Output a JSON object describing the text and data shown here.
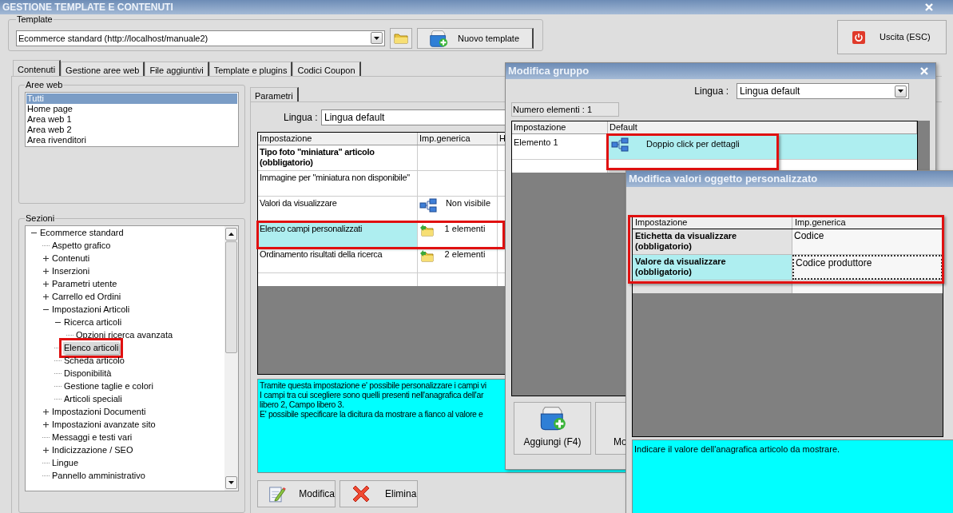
{
  "window": {
    "title": "GESTIONE TEMPLATE E CONTENUTI"
  },
  "template": {
    "label": "Template",
    "value": "Ecommerce standard (http://localhost/manuale2)",
    "new_button": "Nuovo template"
  },
  "exit_button": "Uscita (ESC)",
  "tabs": [
    {
      "label": "Contenuti",
      "selected": true
    },
    {
      "label": "Gestione aree web",
      "selected": false
    },
    {
      "label": "File aggiuntivi",
      "selected": false
    },
    {
      "label": "Template e plugins",
      "selected": false
    },
    {
      "label": "Codici Coupon",
      "selected": false
    }
  ],
  "web_areas": {
    "label": "Aree web",
    "items": [
      {
        "label": "Tutti",
        "selected": true
      },
      {
        "label": "Home page",
        "selected": false
      },
      {
        "label": "Area web 1",
        "selected": false
      },
      {
        "label": "Area web 2",
        "selected": false
      },
      {
        "label": "Area rivenditori",
        "selected": false
      }
    ]
  },
  "sections": {
    "label": "Sezioni",
    "tree": [
      {
        "label": "Ecommerce standard",
        "kind": "branch",
        "expanded": true,
        "selected": false,
        "highlighted": false,
        "children": [
          {
            "label": "Aspetto grafico",
            "kind": "leaf",
            "selected": false,
            "highlighted": false
          },
          {
            "label": "Contenuti",
            "kind": "branch",
            "expanded": false,
            "selected": false,
            "highlighted": false
          },
          {
            "label": "Inserzioni",
            "kind": "branch",
            "expanded": false,
            "selected": false,
            "highlighted": false
          },
          {
            "label": "Parametri utente",
            "kind": "branch",
            "expanded": false,
            "selected": false,
            "highlighted": false
          },
          {
            "label": "Carrello ed Ordini",
            "kind": "branch",
            "expanded": false,
            "selected": false,
            "highlighted": false
          },
          {
            "label": "Impostazioni Articoli",
            "kind": "branch",
            "expanded": true,
            "selected": false,
            "highlighted": false,
            "children": [
              {
                "label": "Ricerca articoli",
                "kind": "branch",
                "expanded": true,
                "selected": false,
                "highlighted": false,
                "children": [
                  {
                    "label": "Opzioni ricerca avanzata",
                    "kind": "leaf",
                    "selected": false,
                    "highlighted": false
                  }
                ]
              },
              {
                "label": "Elenco articoli",
                "kind": "leaf",
                "selected": true,
                "highlighted": true
              },
              {
                "label": "Scheda articolo",
                "kind": "leaf",
                "selected": false,
                "highlighted": false
              },
              {
                "label": "Disponibilità",
                "kind": "leaf",
                "selected": false,
                "highlighted": false
              },
              {
                "label": "Gestione taglie e colori",
                "kind": "leaf",
                "selected": false,
                "highlighted": false
              },
              {
                "label": "Articoli speciali",
                "kind": "leaf",
                "selected": false,
                "highlighted": false
              }
            ]
          },
          {
            "label": "Impostazioni Documenti",
            "kind": "branch",
            "expanded": false,
            "selected": false,
            "highlighted": false
          },
          {
            "label": "Impostazioni avanzate sito",
            "kind": "branch",
            "expanded": false,
            "selected": false,
            "highlighted": false
          },
          {
            "label": "Messaggi e testi vari",
            "kind": "leaf",
            "selected": false,
            "highlighted": false
          },
          {
            "label": "Indicizzazione / SEO",
            "kind": "branch",
            "expanded": false,
            "selected": false,
            "highlighted": false
          },
          {
            "label": "Lingue",
            "kind": "leaf",
            "selected": false,
            "highlighted": false
          },
          {
            "label": "Pannello amministrativo",
            "kind": "leaf",
            "selected": false,
            "highlighted": false
          }
        ]
      }
    ]
  },
  "parameters": {
    "tab": "Parametri",
    "language_label": "Lingua :",
    "language_value": "Lingua default",
    "columns": [
      "Impostazione",
      "Imp.generica",
      "H"
    ],
    "rows": [
      {
        "label": "Tipo foto \"miniatura\" articolo (obbligatorio)",
        "bold": true,
        "kind": "plain",
        "selected": false,
        "highlighted": false
      },
      {
        "label": "Immagine per \"miniatura non disponibile\"",
        "bold": false,
        "kind": "plain",
        "selected": false,
        "highlighted": false
      },
      {
        "label": "Valori da visualizzare",
        "bold": false,
        "kind": "detail",
        "value": "Non visibile",
        "selected": false,
        "highlighted": false
      },
      {
        "label": "Elenco campi personalizzati",
        "bold": false,
        "kind": "list",
        "value": "1 elementi",
        "selected": true,
        "highlighted": true
      },
      {
        "label": "Ordinamento risultati della ricerca",
        "bold": false,
        "kind": "list",
        "value": "2 elementi",
        "selected": false,
        "highlighted": false
      }
    ],
    "description": [
      "Tramite questa impostazione e' possibile personalizzare i campi vi",
      "I campi tra cui scegliere sono quelli presenti nell'anagrafica dell'ar",
      "libero 2, Campo libero 3.",
      "E' possibile specificare la dicitura da mostrare a fianco al valore e"
    ],
    "buttons": [
      {
        "label": "Modifica",
        "kind": "edit"
      },
      {
        "label": "Elimina",
        "kind": "delete"
      }
    ]
  },
  "group_dialog": {
    "title": "Modifica gruppo",
    "language_label": "Lingua :",
    "language_value": "Lingua default",
    "count": "Numero elementi : 1",
    "columns": [
      "Impostazione",
      "Default"
    ],
    "rows": [
      {
        "label": "Elemento 1",
        "value": "Doppio click per dettagli",
        "selected": true,
        "highlighted": true
      }
    ],
    "buttons": [
      {
        "label": "Aggiungi (F4)",
        "kind": "add"
      },
      {
        "label": "Mo",
        "kind": "clipped"
      }
    ]
  },
  "object_dialog": {
    "title": "Modifica valori oggetto personalizzato",
    "highlighted": true,
    "columns": [
      "Impostazione",
      "Imp.generica"
    ],
    "rows": [
      {
        "label": "Etichetta da visualizzare (obbligatorio)",
        "value": "Codice",
        "bold": true,
        "selected": false,
        "focused": false
      },
      {
        "label": "Valore da visualizzare (obbligatorio)",
        "value": "Codice produttore",
        "bold": true,
        "selected": true,
        "focused": true
      }
    ],
    "description": "Indicare il valore dell'anagrafica articolo da mostrare."
  }
}
